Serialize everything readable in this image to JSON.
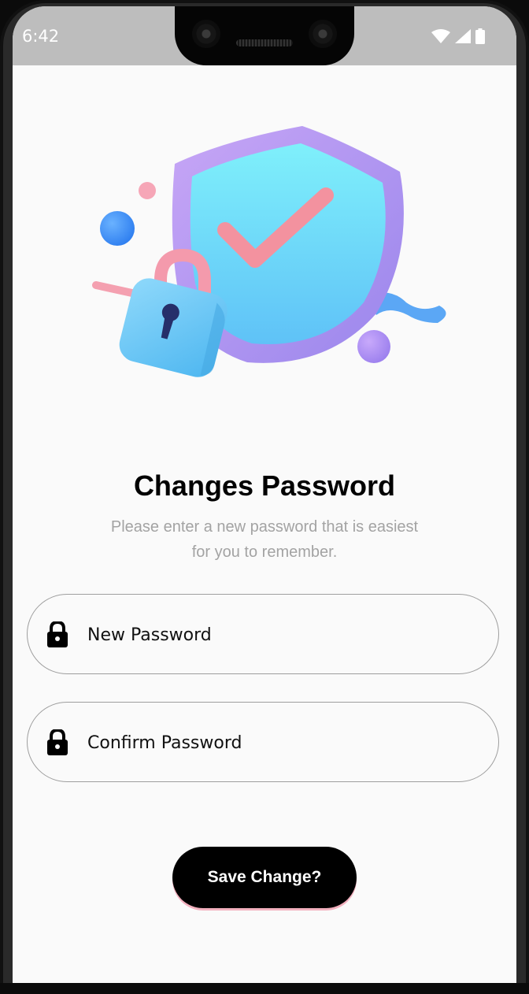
{
  "status_bar": {
    "time": "6:42",
    "icons": [
      "wifi-icon",
      "cellular-signal-icon",
      "battery-icon"
    ]
  },
  "illustration": {
    "icons": [
      "shield-icon",
      "checkmark-icon",
      "padlock-icon",
      "sphere-icon",
      "ribbon-icon"
    ]
  },
  "header": {
    "title": "Changes Password",
    "subtitle_line1": "Please enter a new password that is easiest",
    "subtitle_line2": "for you to remember."
  },
  "form": {
    "new_password": {
      "placeholder": "New Password",
      "value": "",
      "icon": "lock-icon"
    },
    "confirm_password": {
      "placeholder": "Confirm Password",
      "value": "",
      "icon": "lock-icon"
    }
  },
  "actions": {
    "save_label": "Save Change?"
  },
  "colors": {
    "accent": "#000000",
    "button_shadow": "#f3b1bf",
    "subtitle": "#a3a3a3",
    "field_border": "#9e9e9e"
  }
}
